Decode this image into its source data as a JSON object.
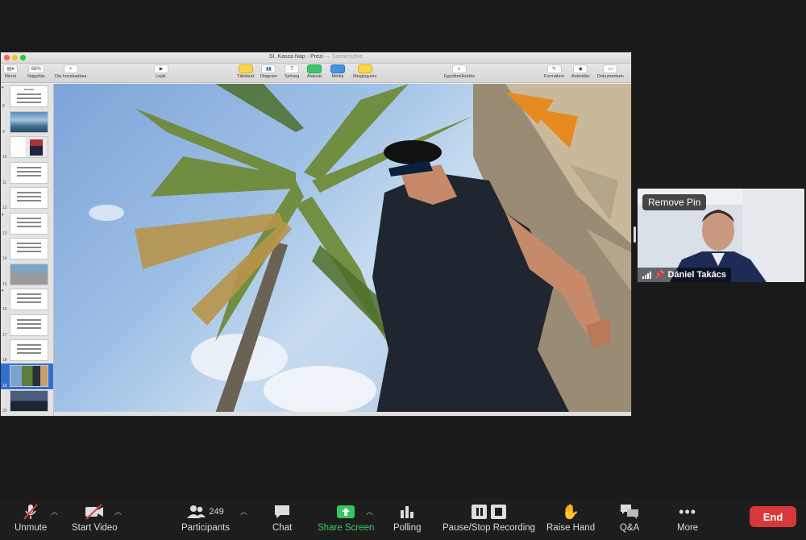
{
  "window": {
    "title": "SI. Kasza Nap - Prezi",
    "title_suffix": "— Szerkesztve",
    "traffic_lights": [
      "#ff5f57",
      "#febc2e",
      "#28c840"
    ]
  },
  "toolbar": {
    "view": "Nézet",
    "zoom_value": "68%",
    "zoom_label": "Nagyítás",
    "add_slide": "Dia hozzáadása",
    "play": "Leját.",
    "table": "Táblázat",
    "chart": "Diagram",
    "text": "Szöveg",
    "shape": "Alakzat",
    "media": "Média",
    "comment": "Megjegyzés",
    "collaborate": "Együttműködés",
    "format": "Formátum",
    "animate": "Animálás",
    "document": "Dokumentum"
  },
  "slides": [
    {
      "num": "8",
      "kind": "text",
      "title": "Tartalom"
    },
    {
      "num": "9",
      "kind": "img-sea"
    },
    {
      "num": "10",
      "kind": "img-person"
    },
    {
      "num": "11",
      "kind": "text"
    },
    {
      "num": "12",
      "kind": "text"
    },
    {
      "num": "13",
      "kind": "text"
    },
    {
      "num": "14",
      "kind": "text"
    },
    {
      "num": "15",
      "kind": "img-car"
    },
    {
      "num": "16",
      "kind": "text"
    },
    {
      "num": "17",
      "kind": "text"
    },
    {
      "num": "18",
      "kind": "text"
    },
    {
      "num": "19",
      "kind": "img-palm",
      "selected": true
    },
    {
      "num": "20",
      "kind": "img-group"
    }
  ],
  "participant": {
    "remove_pin": "Remove Pin",
    "name": "Dániel Takács"
  },
  "bottom_bar": {
    "unmute": "Unmute",
    "start_video": "Start Video",
    "participants": "Participants",
    "participants_count": "249",
    "chat": "Chat",
    "share_screen": "Share Screen",
    "polling": "Polling",
    "recording": "Pause/Stop Recording",
    "raise_hand": "Raise Hand",
    "qa": "Q&A",
    "more": "More",
    "end": "End"
  },
  "colors": {
    "end_button": "#d73838",
    "share_green": "#33c661",
    "selection_blue": "#2f6fd0"
  }
}
